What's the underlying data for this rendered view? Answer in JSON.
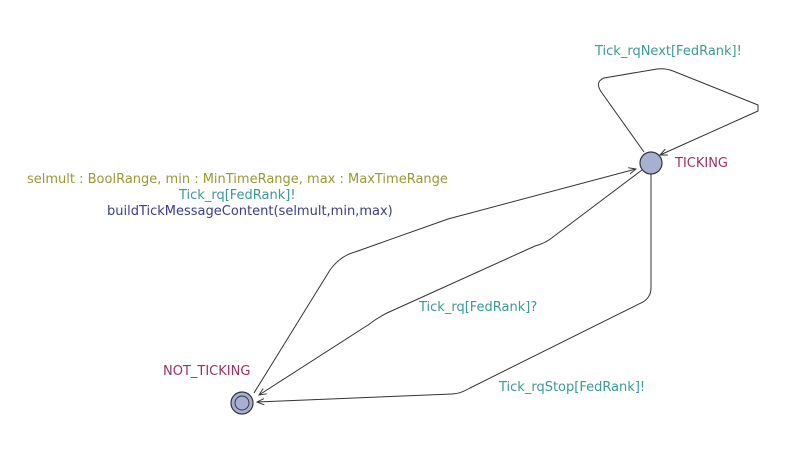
{
  "automaton": {
    "locations": [
      {
        "id": "ticking",
        "name": "TICKING",
        "initial": false,
        "color": "#a8b0d0"
      },
      {
        "id": "not_ticking",
        "name": "NOT_TICKING",
        "initial": true,
        "color": "#a8b0d0"
      }
    ],
    "edges": [
      {
        "id": "self_loop",
        "from": "TICKING",
        "to": "TICKING",
        "sync": "Tick_rqNext[FedRank]!"
      },
      {
        "id": "start",
        "from": "NOT_TICKING",
        "to": "TICKING",
        "select": "selmult : BoolRange, min : MinTimeRange, max : MaxTimeRange",
        "sync": "Tick_rq[FedRank]!",
        "update": "buildTickMessageContent(selmult,min,max)"
      },
      {
        "id": "request",
        "from": "TICKING",
        "to": "NOT_TICKING",
        "sync": "Tick_rq[FedRank]?"
      },
      {
        "id": "stop",
        "from": "TICKING",
        "to": "NOT_TICKING",
        "sync": "Tick_rqStop[FedRank]!"
      }
    ]
  },
  "colors": {
    "location_name": "#993366",
    "sync": "#3a9a9a",
    "select": "#999933",
    "update": "#3c3c8c",
    "edge": "#333333",
    "location_fill": "#a8b0d0"
  }
}
